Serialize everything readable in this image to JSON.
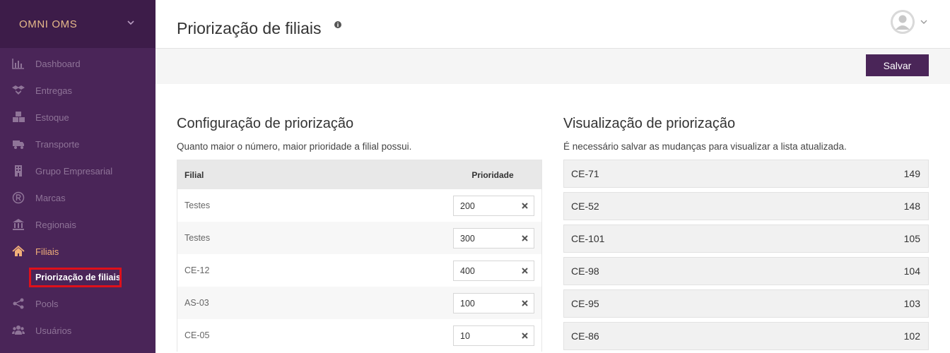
{
  "brand": {
    "title": "OMNI OMS"
  },
  "sidebar": {
    "items": [
      {
        "label": "Dashboard",
        "icon": "bar-chart-icon"
      },
      {
        "label": "Entregas",
        "icon": "dropbox-icon"
      },
      {
        "label": "Estoque",
        "icon": "cubes-icon"
      },
      {
        "label": "Transporte",
        "icon": "truck-icon"
      },
      {
        "label": "Grupo Empresarial",
        "icon": "building-icon"
      },
      {
        "label": "Marcas",
        "icon": "registered-icon"
      },
      {
        "label": "Regionais",
        "icon": "bank-icon"
      },
      {
        "label": "Filiais",
        "icon": "home-icon"
      },
      {
        "label": "Pools",
        "icon": "share-icon"
      },
      {
        "label": "Usuários",
        "icon": "users-icon"
      }
    ],
    "subitem": {
      "label": "Priorização de filiais"
    }
  },
  "header": {
    "title": "Priorização de filiais"
  },
  "toolbar": {
    "save_label": "Salvar"
  },
  "config": {
    "title": "Configuração de priorização",
    "description": "Quanto maior o número, maior prioridade a filial possui.",
    "col_filial": "Filial",
    "col_prioridade": "Prioridade",
    "rows": [
      {
        "name": "Testes",
        "priority": "200"
      },
      {
        "name": "Testes",
        "priority": "300"
      },
      {
        "name": "CE-12",
        "priority": "400"
      },
      {
        "name": "AS-03",
        "priority": "100"
      },
      {
        "name": "CE-05",
        "priority": "10"
      }
    ]
  },
  "viz": {
    "title": "Visualização de priorização",
    "description": "É necessário salvar as mudanças para visualizar a lista atualizada.",
    "items": [
      {
        "name": "CE-71",
        "value": "149"
      },
      {
        "name": "CE-52",
        "value": "148"
      },
      {
        "name": "CE-101",
        "value": "105"
      },
      {
        "name": "CE-98",
        "value": "104"
      },
      {
        "name": "CE-95",
        "value": "103"
      },
      {
        "name": "CE-86",
        "value": "102"
      }
    ]
  },
  "colors": {
    "sidebar": "#4a2558",
    "brand_bg": "#3d1c49",
    "accent": "#f2b079",
    "highlight": "#e0101a"
  }
}
